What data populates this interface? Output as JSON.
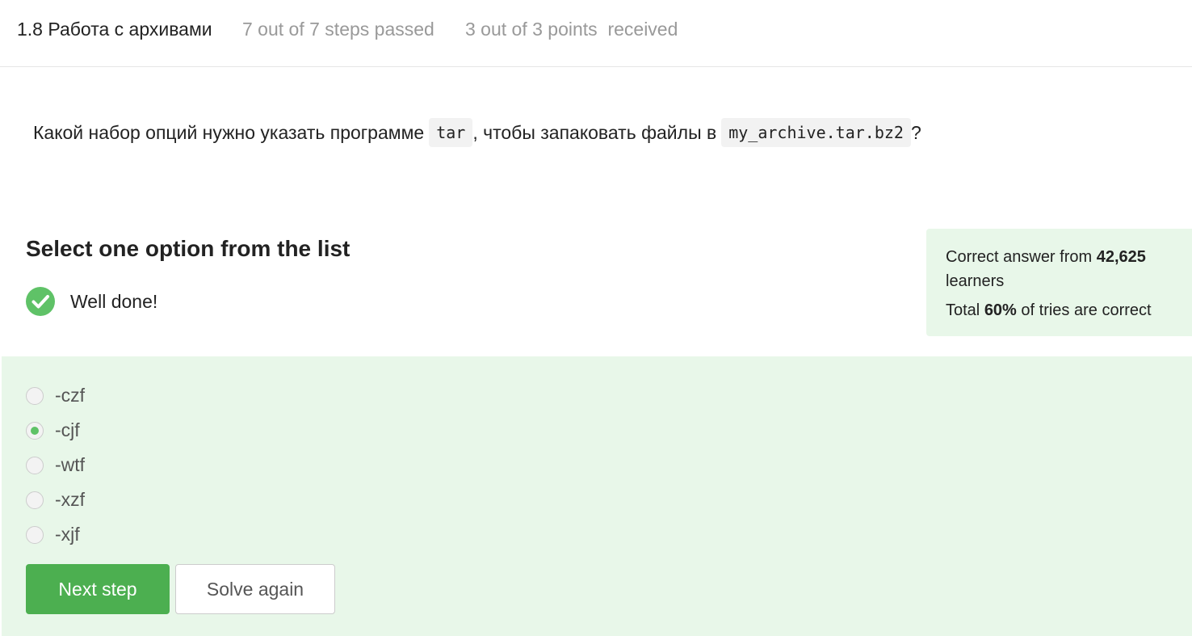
{
  "header": {
    "lesson_title": "1.8 Работа с архивами",
    "steps_progress": "7 out of 7 steps passed",
    "points_progress": "3 out of 3 points  received"
  },
  "question": {
    "text_before": "Какой набор опций нужно указать программе",
    "code_1": "tar",
    "text_middle": ", чтобы запаковать файлы в",
    "code_2": "my_archive.tar.bz2",
    "text_after": "?"
  },
  "quiz": {
    "title": "Select one option from the list",
    "feedback": "Well done!",
    "feedback_icon": "check-circle-icon"
  },
  "stats": {
    "line1_prefix": "Correct answer from",
    "learners_count": "42,625",
    "line1_suffix": "learners",
    "line2_prefix": "Total",
    "percent": "60%",
    "line2_suffix": "of tries are correct"
  },
  "options": [
    {
      "label": "-czf",
      "selected": false
    },
    {
      "label": "-cjf",
      "selected": true
    },
    {
      "label": "-wtf",
      "selected": false
    },
    {
      "label": "-xzf",
      "selected": false
    },
    {
      "label": "-xjf",
      "selected": false
    }
  ],
  "buttons": {
    "next": "Next step",
    "again": "Solve again"
  },
  "colors": {
    "accent_green": "#4caf50",
    "check_green": "#5fc267",
    "answer_bg": "#e8f7e9",
    "muted_text": "#999999"
  }
}
